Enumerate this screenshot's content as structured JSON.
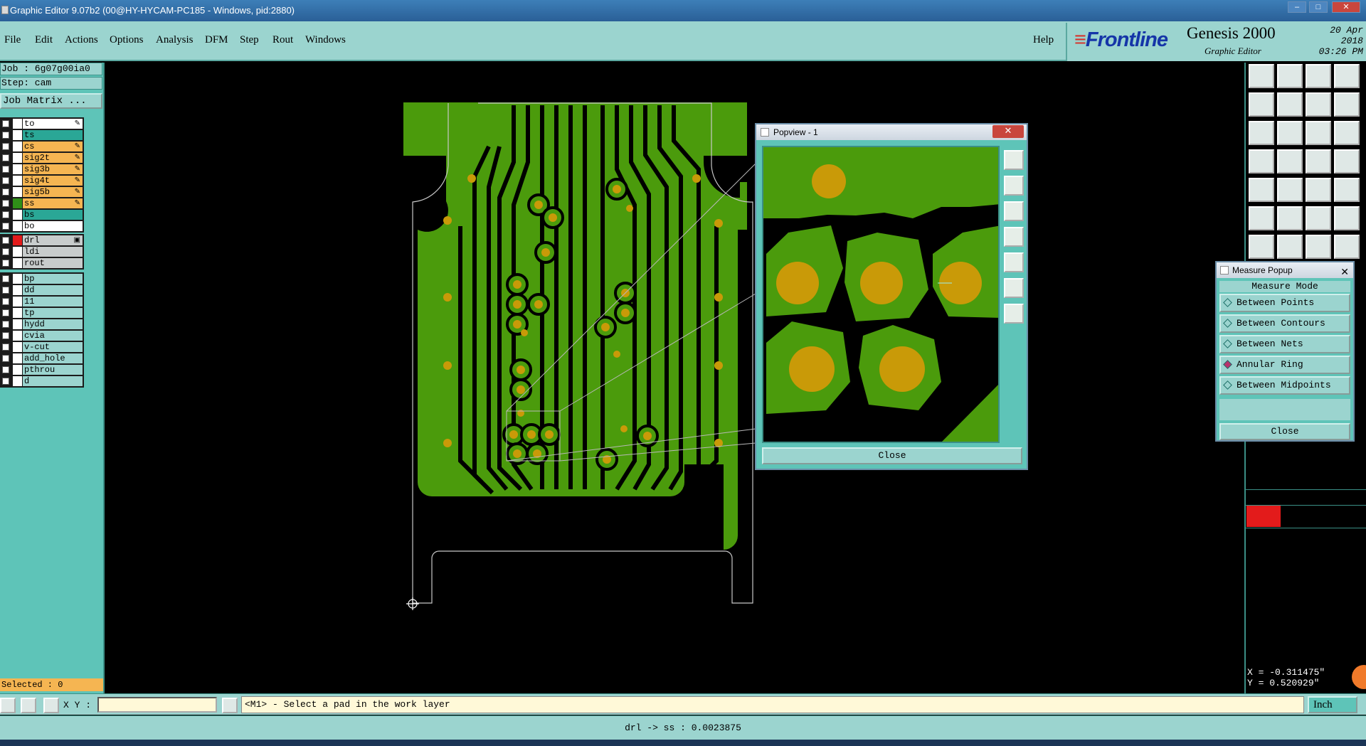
{
  "window": {
    "title": "Graphic Editor 9.07b2 (00@HY-HYCAM-PC185 - Windows, pid:2880)",
    "minimize": "–",
    "maximize": "□",
    "close": "✕"
  },
  "menu": {
    "items": [
      "File",
      "Edit",
      "Actions",
      "Options",
      "Analysis",
      "DFM",
      "Step",
      "Rout",
      "Windows"
    ],
    "help": "Help"
  },
  "brand": {
    "logo": "Frontline",
    "product": "Genesis 2000",
    "subtitle": "Graphic Editor",
    "date": "20 Apr 2018",
    "time": "03:26 PM"
  },
  "job": {
    "job_line": "Job : 6g07g00ia0",
    "step_line": "Step: cam",
    "matrix_button": "Job Matrix ..."
  },
  "layers_top": [
    {
      "name": "to",
      "color": "#ffffff",
      "swatch": "#ffffff",
      "mark": "✎"
    },
    {
      "name": "ts",
      "color": "#2aa796",
      "swatch": "#ffffff",
      "mark": ""
    },
    {
      "name": "cs",
      "color": "#f5b552",
      "swatch": "#ffffff",
      "mark": "✎"
    },
    {
      "name": "sig2t",
      "color": "#f5b552",
      "swatch": "#ffffff",
      "mark": "✎"
    },
    {
      "name": "sig3b",
      "color": "#f5b552",
      "swatch": "#ffffff",
      "mark": "✎"
    },
    {
      "name": "sig4t",
      "color": "#f5b552",
      "swatch": "#ffffff",
      "mark": "✎"
    },
    {
      "name": "sig5b",
      "color": "#f5b552",
      "swatch": "#ffffff",
      "mark": "✎"
    },
    {
      "name": "ss",
      "color": "#f5b552",
      "swatch": "#2f8f18",
      "mark": "✎"
    },
    {
      "name": "bs",
      "color": "#2aa796",
      "swatch": "#ffffff",
      "mark": ""
    },
    {
      "name": "bo",
      "color": "#ffffff",
      "swatch": "#ffffff",
      "mark": ""
    }
  ],
  "layers_drill": [
    {
      "name": "drl",
      "color": "#c8cccc",
      "swatch": "#e31b1b",
      "mark": "▣"
    },
    {
      "name": "ldi",
      "color": "#c8cccc",
      "swatch": "#ffffff",
      "mark": ""
    },
    {
      "name": "rout",
      "color": "#c8cccc",
      "swatch": "#ffffff",
      "mark": ""
    }
  ],
  "layers_misc": [
    {
      "name": "bp",
      "color": "#9bd4cf",
      "swatch": "#ffffff",
      "mark": ""
    },
    {
      "name": "dd",
      "color": "#9bd4cf",
      "swatch": "#ffffff",
      "mark": ""
    },
    {
      "name": "11",
      "color": "#9bd4cf",
      "swatch": "#ffffff",
      "mark": ""
    },
    {
      "name": "tp",
      "color": "#9bd4cf",
      "swatch": "#ffffff",
      "mark": ""
    },
    {
      "name": "hydd",
      "color": "#9bd4cf",
      "swatch": "#ffffff",
      "mark": ""
    },
    {
      "name": "cvia",
      "color": "#9bd4cf",
      "swatch": "#ffffff",
      "mark": ""
    },
    {
      "name": "v-cut",
      "color": "#9bd4cf",
      "swatch": "#ffffff",
      "mark": ""
    },
    {
      "name": "add_hole",
      "color": "#9bd4cf",
      "swatch": "#ffffff",
      "mark": ""
    },
    {
      "name": "pthrou",
      "color": "#9bd4cf",
      "swatch": "#ffffff",
      "mark": ""
    },
    {
      "name": "d",
      "color": "#9bd4cf",
      "swatch": "#ffffff",
      "mark": ""
    }
  ],
  "selected": "Selected : 0",
  "colors": {
    "copper": "#4b9b0c",
    "pad": "#c99a08",
    "panel": "#5ec4b8",
    "panel_light": "#9bd4cf",
    "active": "#e31b1b"
  },
  "popview": {
    "title": "Popview - 1",
    "close_x": "✕",
    "close_button": "Close",
    "tool_icons": [
      "zoom-fit-icon",
      "zoom-in-icon",
      "zoom-out-icon",
      "pan-left-icon",
      "pan-right-icon",
      "zoom-box-icon",
      "home-view-icon"
    ]
  },
  "measure": {
    "title": "Measure Popup",
    "close_x": "✕",
    "mode_label": "Measure Mode",
    "options": [
      {
        "label": "Between Points",
        "selected": false
      },
      {
        "label": "Between Contours",
        "selected": false
      },
      {
        "label": "Between Nets",
        "selected": false
      },
      {
        "label": "Annular Ring",
        "selected": true
      },
      {
        "label": "Between Midpoints",
        "selected": false
      }
    ],
    "close_button": "Close"
  },
  "right_toolbar": {
    "icons": [
      "save-icon",
      "load-icon",
      "home-icon",
      "window-icon",
      "step-in-icon",
      "step-out-icon",
      "pan-icon",
      "snap-icon",
      "zoom-fit-icon",
      "zoom-center-icon",
      "scale-1-2-icon",
      "help-icon",
      "edit-tool-icon",
      "grid-icon",
      "net-icon",
      "net-select-icon",
      "pad-select-icon",
      "line-icon",
      "fill-icon",
      "circle-icon",
      "node-icon",
      "cross-icon",
      "dot-line-icon",
      "connect-icon",
      "measure-line-icon",
      "draw-line-icon",
      "arc-icon",
      "layer-icon"
    ]
  },
  "coords": {
    "x": "X = -0.311475\"",
    "y": "Y = 0.520929\""
  },
  "command": {
    "xy_label": "X Y :",
    "xy_value": "",
    "prompt": "<M1> - Select a pad in the work layer",
    "unit": "Inch"
  },
  "status": {
    "message": "drl -> ss : 0.0023875"
  }
}
